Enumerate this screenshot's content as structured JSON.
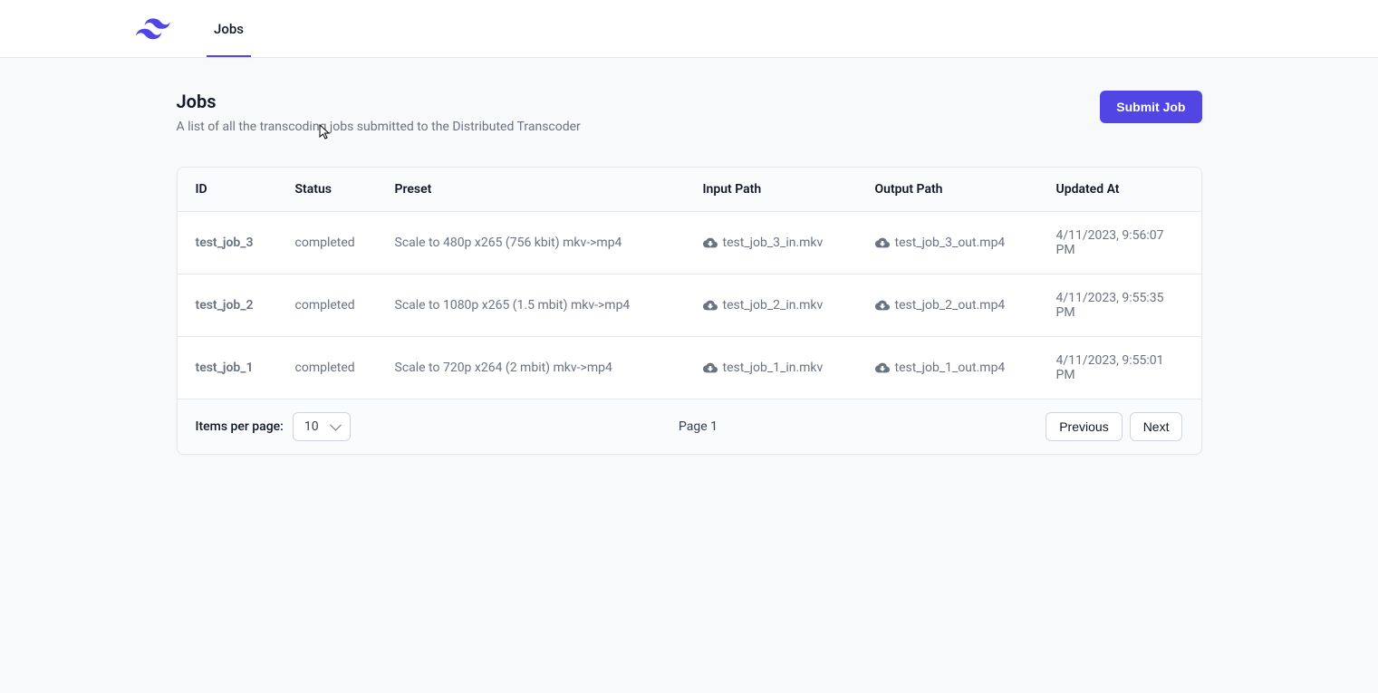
{
  "nav": {
    "jobs": "Jobs"
  },
  "page": {
    "title": "Jobs",
    "description": "A list of all the transcoding jobs submitted to the Distributed Transcoder",
    "submit": "Submit Job"
  },
  "table": {
    "headers": {
      "id": "ID",
      "status": "Status",
      "preset": "Preset",
      "input": "Input Path",
      "output": "Output Path",
      "updated": "Updated At"
    },
    "rows": [
      {
        "id": "test_job_3",
        "status": "completed",
        "preset": "Scale to 480p x265 (756 kbit) mkv->mp4",
        "input": "test_job_3_in.mkv",
        "output": "test_job_3_out.mp4",
        "updated": "4/11/2023, 9:56:07 PM"
      },
      {
        "id": "test_job_2",
        "status": "completed",
        "preset": "Scale to 1080p x265 (1.5 mbit) mkv->mp4",
        "input": "test_job_2_in.mkv",
        "output": "test_job_2_out.mp4",
        "updated": "4/11/2023, 9:55:35 PM"
      },
      {
        "id": "test_job_1",
        "status": "completed",
        "preset": "Scale to 720p x264 (2 mbit) mkv->mp4",
        "input": "test_job_1_in.mkv",
        "output": "test_job_1_out.mp4",
        "updated": "4/11/2023, 9:55:01 PM"
      }
    ]
  },
  "pagination": {
    "items_label": "Items per page:",
    "items_value": "10",
    "page_label": "Page 1",
    "previous": "Previous",
    "next": "Next"
  }
}
